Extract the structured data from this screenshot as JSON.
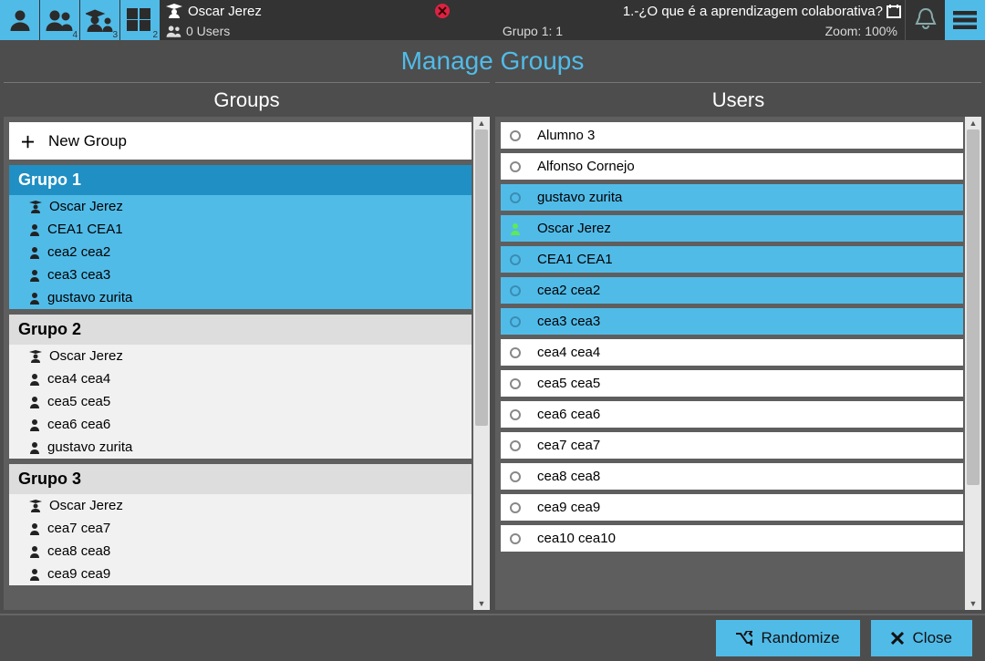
{
  "topbar": {
    "instructor_name": "Oscar Jerez",
    "question": "1.-¿O que é a aprendizagem colaborativa?",
    "users_count_label": "0 Users",
    "group_label": "Grupo 1: 1",
    "zoom_label": "Zoom: 100%",
    "tab2_sub": "4",
    "tab3_sub": "3",
    "tab4_sub": "2"
  },
  "page": {
    "title": "Manage Groups",
    "groups_header": "Groups",
    "users_header": "Users",
    "new_group_label": "New Group"
  },
  "groups": [
    {
      "name": "Grupo 1",
      "selected": true,
      "members": [
        {
          "icon": "teacher",
          "label": "Oscar Jerez"
        },
        {
          "icon": "user",
          "label": "CEA1 CEA1"
        },
        {
          "icon": "user",
          "label": "cea2 cea2"
        },
        {
          "icon": "user",
          "label": "cea3 cea3"
        },
        {
          "icon": "user",
          "label": "gustavo zurita"
        }
      ]
    },
    {
      "name": "Grupo 2",
      "selected": false,
      "members": [
        {
          "icon": "teacher",
          "label": "Oscar Jerez"
        },
        {
          "icon": "user",
          "label": "cea4 cea4"
        },
        {
          "icon": "user",
          "label": "cea5 cea5"
        },
        {
          "icon": "user",
          "label": "cea6 cea6"
        },
        {
          "icon": "user",
          "label": "gustavo zurita"
        }
      ]
    },
    {
      "name": "Grupo 3",
      "selected": false,
      "members": [
        {
          "icon": "teacher",
          "label": "Oscar Jerez"
        },
        {
          "icon": "user",
          "label": "cea7 cea7"
        },
        {
          "icon": "user",
          "label": "cea8 cea8"
        },
        {
          "icon": "user",
          "label": "cea9 cea9"
        }
      ]
    }
  ],
  "users": [
    {
      "label": "Alumno 3",
      "selected": false
    },
    {
      "label": "Alfonso Cornejo",
      "selected": false
    },
    {
      "label": "gustavo zurita",
      "selected": true
    },
    {
      "label": "Oscar Jerez",
      "selected": true,
      "green": true
    },
    {
      "label": "CEA1 CEA1",
      "selected": true
    },
    {
      "label": "cea2 cea2",
      "selected": true
    },
    {
      "label": "cea3 cea3",
      "selected": true
    },
    {
      "label": "cea4 cea4",
      "selected": false
    },
    {
      "label": "cea5 cea5",
      "selected": false
    },
    {
      "label": "cea6 cea6",
      "selected": false
    },
    {
      "label": "cea7 cea7",
      "selected": false
    },
    {
      "label": "cea8 cea8",
      "selected": false
    },
    {
      "label": "cea9 cea9",
      "selected": false
    },
    {
      "label": "cea10 cea10",
      "selected": false
    }
  ],
  "footer": {
    "randomize": "Randomize",
    "close": "Close"
  }
}
